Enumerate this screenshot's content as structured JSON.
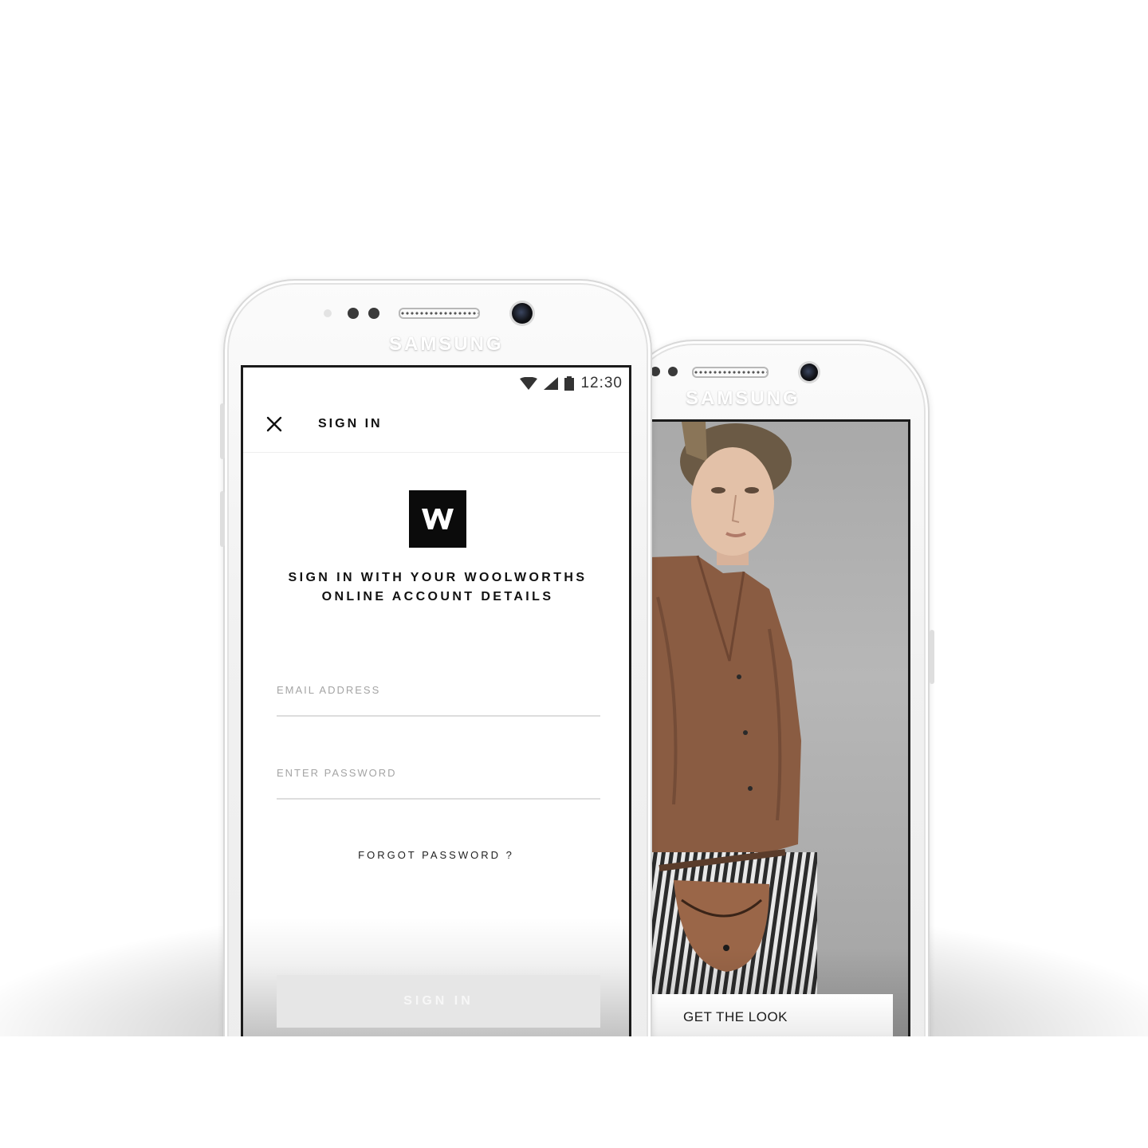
{
  "front_phone": {
    "brand": "SAMSUNG",
    "status_bar": {
      "time": "12:30"
    },
    "toolbar": {
      "title": "SIGN IN",
      "close_icon": "close-icon"
    },
    "logo": {
      "letter": "W"
    },
    "headline_line1": "SIGN IN WITH YOUR WOOLWORTHS",
    "headline_line2": "ONLINE ACCOUNT DETAILS",
    "email_field": {
      "placeholder": "EMAIL ADDRESS",
      "value": ""
    },
    "password_field": {
      "placeholder": "ENTER PASSWORD",
      "value": ""
    },
    "forgot_password": "FORGOT PASSWORD ?",
    "sign_in_button": "SIGN IN"
  },
  "back_phone": {
    "brand": "SAMSUNG",
    "cta_label": "GET THE LOOK"
  },
  "colors": {
    "accent": "#0b0b0b",
    "screen_background": "#ffffff",
    "disabled_button": "#e6e6e6",
    "photo_background": "#a9a9a9"
  }
}
